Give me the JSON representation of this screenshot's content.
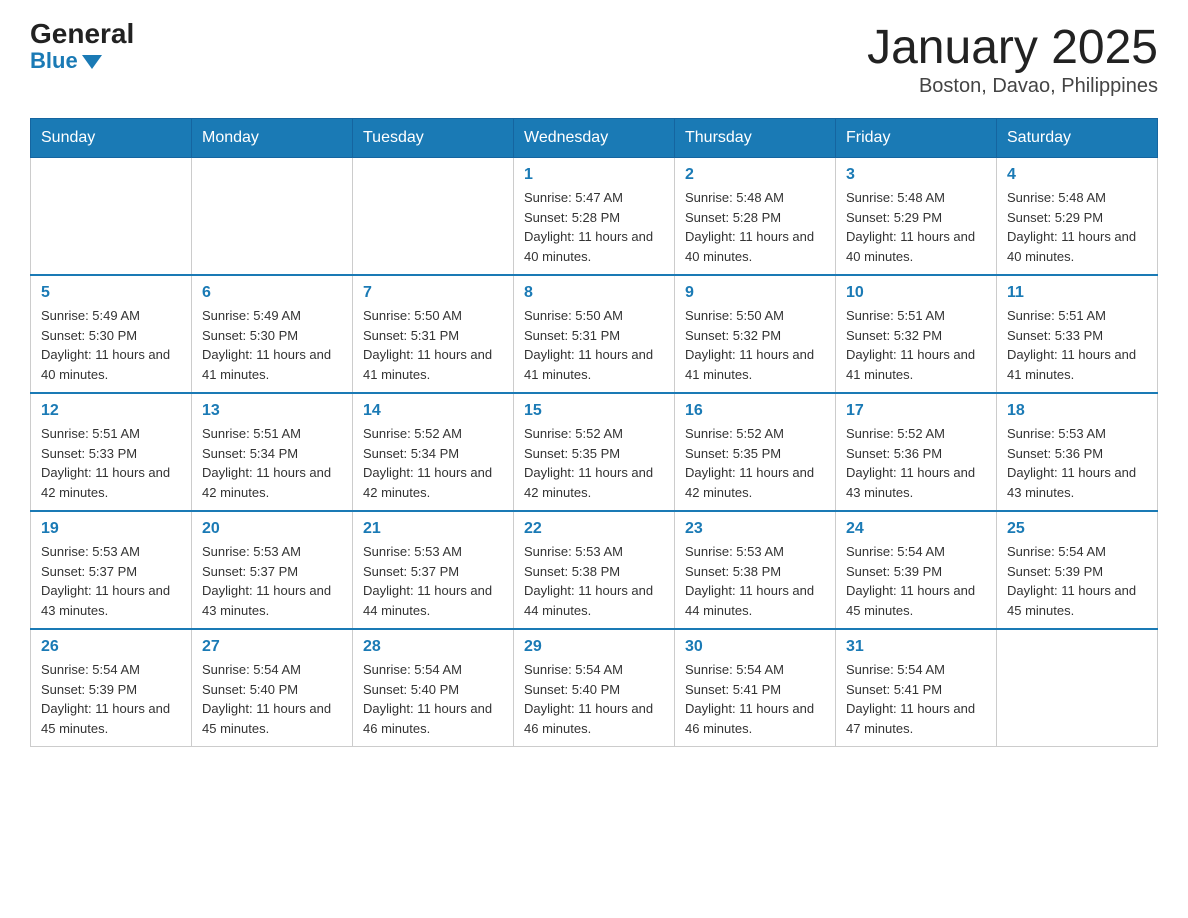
{
  "logo": {
    "general": "General",
    "blue": "Blue"
  },
  "title": "January 2025",
  "location": "Boston, Davao, Philippines",
  "weekdays": [
    "Sunday",
    "Monday",
    "Tuesday",
    "Wednesday",
    "Thursday",
    "Friday",
    "Saturday"
  ],
  "weeks": [
    [
      {
        "day": "",
        "info": ""
      },
      {
        "day": "",
        "info": ""
      },
      {
        "day": "",
        "info": ""
      },
      {
        "day": "1",
        "info": "Sunrise: 5:47 AM\nSunset: 5:28 PM\nDaylight: 11 hours and 40 minutes."
      },
      {
        "day": "2",
        "info": "Sunrise: 5:48 AM\nSunset: 5:28 PM\nDaylight: 11 hours and 40 minutes."
      },
      {
        "day": "3",
        "info": "Sunrise: 5:48 AM\nSunset: 5:29 PM\nDaylight: 11 hours and 40 minutes."
      },
      {
        "day": "4",
        "info": "Sunrise: 5:48 AM\nSunset: 5:29 PM\nDaylight: 11 hours and 40 minutes."
      }
    ],
    [
      {
        "day": "5",
        "info": "Sunrise: 5:49 AM\nSunset: 5:30 PM\nDaylight: 11 hours and 40 minutes."
      },
      {
        "day": "6",
        "info": "Sunrise: 5:49 AM\nSunset: 5:30 PM\nDaylight: 11 hours and 41 minutes."
      },
      {
        "day": "7",
        "info": "Sunrise: 5:50 AM\nSunset: 5:31 PM\nDaylight: 11 hours and 41 minutes."
      },
      {
        "day": "8",
        "info": "Sunrise: 5:50 AM\nSunset: 5:31 PM\nDaylight: 11 hours and 41 minutes."
      },
      {
        "day": "9",
        "info": "Sunrise: 5:50 AM\nSunset: 5:32 PM\nDaylight: 11 hours and 41 minutes."
      },
      {
        "day": "10",
        "info": "Sunrise: 5:51 AM\nSunset: 5:32 PM\nDaylight: 11 hours and 41 minutes."
      },
      {
        "day": "11",
        "info": "Sunrise: 5:51 AM\nSunset: 5:33 PM\nDaylight: 11 hours and 41 minutes."
      }
    ],
    [
      {
        "day": "12",
        "info": "Sunrise: 5:51 AM\nSunset: 5:33 PM\nDaylight: 11 hours and 42 minutes."
      },
      {
        "day": "13",
        "info": "Sunrise: 5:51 AM\nSunset: 5:34 PM\nDaylight: 11 hours and 42 minutes."
      },
      {
        "day": "14",
        "info": "Sunrise: 5:52 AM\nSunset: 5:34 PM\nDaylight: 11 hours and 42 minutes."
      },
      {
        "day": "15",
        "info": "Sunrise: 5:52 AM\nSunset: 5:35 PM\nDaylight: 11 hours and 42 minutes."
      },
      {
        "day": "16",
        "info": "Sunrise: 5:52 AM\nSunset: 5:35 PM\nDaylight: 11 hours and 42 minutes."
      },
      {
        "day": "17",
        "info": "Sunrise: 5:52 AM\nSunset: 5:36 PM\nDaylight: 11 hours and 43 minutes."
      },
      {
        "day": "18",
        "info": "Sunrise: 5:53 AM\nSunset: 5:36 PM\nDaylight: 11 hours and 43 minutes."
      }
    ],
    [
      {
        "day": "19",
        "info": "Sunrise: 5:53 AM\nSunset: 5:37 PM\nDaylight: 11 hours and 43 minutes."
      },
      {
        "day": "20",
        "info": "Sunrise: 5:53 AM\nSunset: 5:37 PM\nDaylight: 11 hours and 43 minutes."
      },
      {
        "day": "21",
        "info": "Sunrise: 5:53 AM\nSunset: 5:37 PM\nDaylight: 11 hours and 44 minutes."
      },
      {
        "day": "22",
        "info": "Sunrise: 5:53 AM\nSunset: 5:38 PM\nDaylight: 11 hours and 44 minutes."
      },
      {
        "day": "23",
        "info": "Sunrise: 5:53 AM\nSunset: 5:38 PM\nDaylight: 11 hours and 44 minutes."
      },
      {
        "day": "24",
        "info": "Sunrise: 5:54 AM\nSunset: 5:39 PM\nDaylight: 11 hours and 45 minutes."
      },
      {
        "day": "25",
        "info": "Sunrise: 5:54 AM\nSunset: 5:39 PM\nDaylight: 11 hours and 45 minutes."
      }
    ],
    [
      {
        "day": "26",
        "info": "Sunrise: 5:54 AM\nSunset: 5:39 PM\nDaylight: 11 hours and 45 minutes."
      },
      {
        "day": "27",
        "info": "Sunrise: 5:54 AM\nSunset: 5:40 PM\nDaylight: 11 hours and 45 minutes."
      },
      {
        "day": "28",
        "info": "Sunrise: 5:54 AM\nSunset: 5:40 PM\nDaylight: 11 hours and 46 minutes."
      },
      {
        "day": "29",
        "info": "Sunrise: 5:54 AM\nSunset: 5:40 PM\nDaylight: 11 hours and 46 minutes."
      },
      {
        "day": "30",
        "info": "Sunrise: 5:54 AM\nSunset: 5:41 PM\nDaylight: 11 hours and 46 minutes."
      },
      {
        "day": "31",
        "info": "Sunrise: 5:54 AM\nSunset: 5:41 PM\nDaylight: 11 hours and 47 minutes."
      },
      {
        "day": "",
        "info": ""
      }
    ]
  ]
}
